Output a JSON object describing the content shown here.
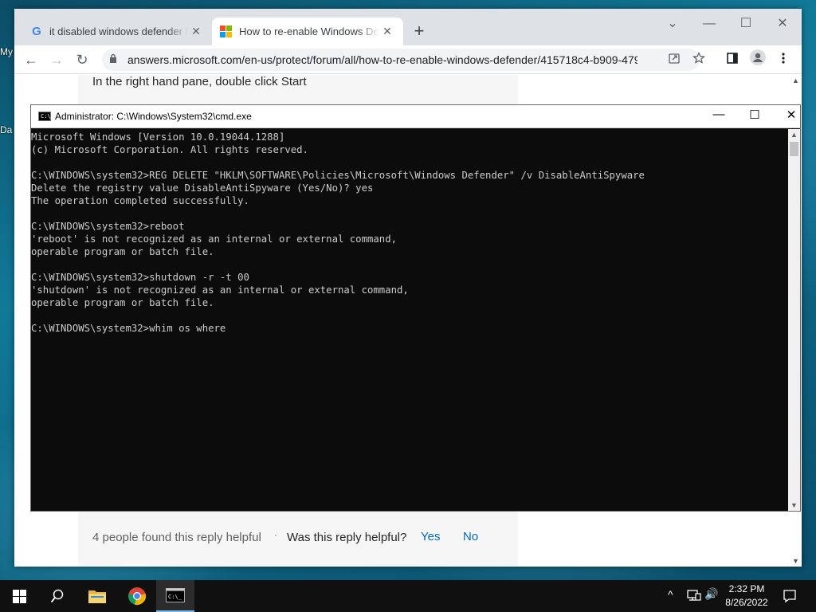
{
  "desktop": {
    "icon_labels": [
      "My",
      "Da"
    ]
  },
  "browser": {
    "tabs": [
      {
        "label": "it disabled windows defender how to turn it back on",
        "favicon": "google-icon"
      },
      {
        "label": "How to re-enable Windows Defender",
        "favicon": "microsoft-icon"
      }
    ],
    "close_glyph": "✕",
    "new_tab": "+",
    "window_controls": {
      "dropdown": "⌄",
      "minimize": "—",
      "maximize": "☐",
      "close": "✕"
    },
    "nav": {
      "back": "←",
      "forward": "→",
      "reload": "↻"
    },
    "url": "answers.microsoft.com/en-us/protect/forum/all/how-to-re-enable-windows-defender/415718c4-b909-479...",
    "page": {
      "instruction": "In the right hand pane, double click Start",
      "helpful_count": "4 people found this reply helpful",
      "separator": "·",
      "question": "Was this reply helpful?",
      "yes": "Yes",
      "no": "No"
    }
  },
  "cmd": {
    "title": "Administrator: C:\\Windows\\System32\\cmd.exe",
    "lines": [
      "Microsoft Windows [Version 10.0.19044.1288]",
      "(c) Microsoft Corporation. All rights reserved.",
      "",
      "C:\\WINDOWS\\system32>REG DELETE \"HKLM\\SOFTWARE\\Policies\\Microsoft\\Windows Defender\" /v DisableAntiSpyware",
      "Delete the registry value DisableAntiSpyware (Yes/No)? yes",
      "The operation completed successfully.",
      "",
      "C:\\WINDOWS\\system32>reboot",
      "'reboot' is not recognized as an internal or external command,",
      "operable program or batch file.",
      "",
      "C:\\WINDOWS\\system32>shutdown -r -t 00",
      "'shutdown' is not recognized as an internal or external command,",
      "operable program or batch file.",
      "",
      "C:\\WINDOWS\\system32>whim os where"
    ],
    "controls": {
      "minimize": "—",
      "maximize": "☐",
      "close": "✕"
    }
  },
  "taskbar": {
    "apps": [
      "start-icon",
      "search-icon",
      "file-explorer-icon",
      "chrome-icon",
      "cmd-icon"
    ],
    "time": "2:32 PM",
    "date": "8/26/2022",
    "tray": {
      "chevron": "^",
      "speaker": "🔊"
    }
  }
}
